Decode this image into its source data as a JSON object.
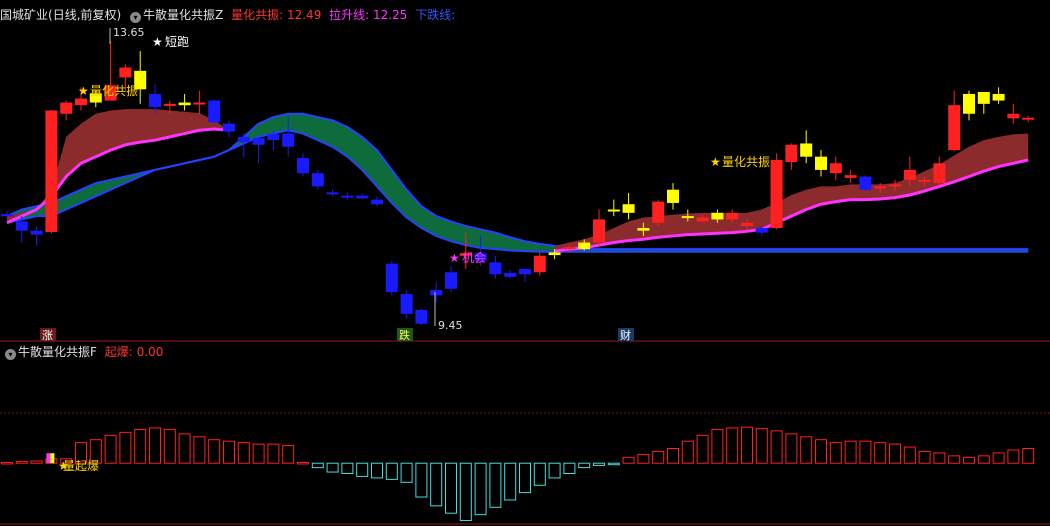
{
  "header_main": {
    "stock": "国城矿业",
    "period": "(日线,前复权)",
    "indicator_name": "牛散量化共振Z",
    "items": [
      {
        "label": "量化共振:",
        "value": "12.49",
        "color": "#ff3333"
      },
      {
        "label": "拉升线:",
        "value": "12.25",
        "color": "#ff33ff"
      },
      {
        "label": "下跌线:",
        "value": "",
        "color": "#3355ff"
      }
    ]
  },
  "header_sub": {
    "indicator_name": "牛散量化共振F",
    "items": [
      {
        "label": "起爆:",
        "value": "0.00",
        "color": "#ff3333"
      }
    ]
  },
  "annotations": {
    "high_label": "13.65",
    "low_label": "9.45",
    "sprint": "短跑",
    "resonance_1": "量化共振",
    "resonance_2": "量化共振",
    "chance": "机会",
    "explosion": "量起爆",
    "tag_zhang": "涨",
    "tag_die": "跌",
    "tag_cai": "财"
  },
  "colors": {
    "up": "#ff2020",
    "down": "#1a1aff",
    "yellow": "#ffff00",
    "upper_band_fill": "#0e6b3c",
    "lower_band_fill": "#8c2b2b",
    "support_line": "#ff33ff",
    "band_edge": "#2244ff",
    "osc_pos": "#ff2020",
    "osc_neg": "#44dddd"
  },
  "chart_data": [
    {
      "type": "candlestick",
      "price_range": [
        9.2,
        14.0
      ],
      "candles": [
        {
          "o": 11.0,
          "h": 11.08,
          "l": 10.96,
          "c": 11.03,
          "k": "down"
        },
        {
          "o": 10.92,
          "h": 11.0,
          "l": 10.6,
          "c": 10.78,
          "k": "down"
        },
        {
          "o": 10.78,
          "h": 10.85,
          "l": 10.55,
          "c": 10.72,
          "k": "down"
        },
        {
          "o": 10.76,
          "h": 12.6,
          "l": 10.74,
          "c": 12.6,
          "k": "up"
        },
        {
          "o": 12.55,
          "h": 12.75,
          "l": 12.45,
          "c": 12.72,
          "k": "up"
        },
        {
          "o": 12.68,
          "h": 12.95,
          "l": 12.6,
          "c": 12.78,
          "k": "up"
        },
        {
          "o": 12.72,
          "h": 12.9,
          "l": 12.65,
          "c": 12.86,
          "k": "yellow"
        },
        {
          "o": 12.75,
          "h": 13.65,
          "l": 12.75,
          "c": 12.98,
          "k": "up"
        },
        {
          "o": 13.1,
          "h": 13.3,
          "l": 12.9,
          "c": 13.25,
          "k": "up"
        },
        {
          "o": 13.2,
          "h": 13.5,
          "l": 12.7,
          "c": 12.92,
          "k": "yellow"
        },
        {
          "o": 12.85,
          "h": 13.0,
          "l": 12.55,
          "c": 12.65,
          "k": "down"
        },
        {
          "o": 12.68,
          "h": 12.75,
          "l": 12.55,
          "c": 12.7,
          "k": "up"
        },
        {
          "o": 12.72,
          "h": 12.85,
          "l": 12.6,
          "c": 12.68,
          "k": "yellow"
        },
        {
          "o": 12.7,
          "h": 12.9,
          "l": 12.55,
          "c": 12.72,
          "k": "up"
        },
        {
          "o": 12.75,
          "h": 12.76,
          "l": 12.4,
          "c": 12.42,
          "k": "down"
        },
        {
          "o": 12.4,
          "h": 12.45,
          "l": 12.2,
          "c": 12.28,
          "k": "down"
        },
        {
          "o": 12.2,
          "h": 12.25,
          "l": 11.9,
          "c": 12.12,
          "k": "down"
        },
        {
          "o": 12.18,
          "h": 12.2,
          "l": 11.8,
          "c": 12.08,
          "k": "down"
        },
        {
          "o": 12.24,
          "h": 12.28,
          "l": 12.0,
          "c": 12.15,
          "k": "down"
        },
        {
          "o": 12.25,
          "h": 12.5,
          "l": 11.9,
          "c": 12.05,
          "k": "down"
        },
        {
          "o": 11.88,
          "h": 11.95,
          "l": 11.6,
          "c": 11.65,
          "k": "down"
        },
        {
          "o": 11.65,
          "h": 11.7,
          "l": 11.4,
          "c": 11.45,
          "k": "down"
        },
        {
          "o": 11.36,
          "h": 11.4,
          "l": 11.3,
          "c": 11.33,
          "k": "down"
        },
        {
          "o": 11.31,
          "h": 11.36,
          "l": 11.25,
          "c": 11.31,
          "k": "down"
        },
        {
          "o": 11.31,
          "h": 11.34,
          "l": 11.26,
          "c": 11.27,
          "k": "down"
        },
        {
          "o": 11.25,
          "h": 11.3,
          "l": 11.15,
          "c": 11.18,
          "k": "down"
        },
        {
          "o": 10.28,
          "h": 10.32,
          "l": 9.8,
          "c": 9.85,
          "k": "down"
        },
        {
          "o": 9.82,
          "h": 9.88,
          "l": 9.45,
          "c": 9.52,
          "k": "down"
        },
        {
          "o": 9.58,
          "h": 9.6,
          "l": 9.35,
          "c": 9.37,
          "k": "down"
        },
        {
          "o": 9.8,
          "h": 10.0,
          "l": 9.7,
          "c": 9.88,
          "k": "down"
        },
        {
          "o": 9.9,
          "h": 10.25,
          "l": 9.85,
          "c": 10.15,
          "k": "down"
        },
        {
          "o": 10.4,
          "h": 10.75,
          "l": 10.2,
          "c": 10.44,
          "k": "up"
        },
        {
          "o": 10.44,
          "h": 10.7,
          "l": 10.25,
          "c": 10.32,
          "k": "down"
        },
        {
          "o": 10.3,
          "h": 10.4,
          "l": 10.05,
          "c": 10.12,
          "k": "down"
        },
        {
          "o": 10.14,
          "h": 10.18,
          "l": 10.05,
          "c": 10.08,
          "k": "down"
        },
        {
          "o": 10.12,
          "h": 10.2,
          "l": 10.0,
          "c": 10.2,
          "k": "down"
        },
        {
          "o": 10.15,
          "h": 10.45,
          "l": 10.1,
          "c": 10.4,
          "k": "up"
        },
        {
          "o": 10.41,
          "h": 10.5,
          "l": 10.35,
          "c": 10.45,
          "k": "yellow"
        },
        {
          "o": 10.52,
          "h": 10.55,
          "l": 10.45,
          "c": 10.53,
          "k": "up"
        },
        {
          "o": 10.5,
          "h": 10.65,
          "l": 10.48,
          "c": 10.6,
          "k": "yellow"
        },
        {
          "o": 10.6,
          "h": 11.1,
          "l": 10.55,
          "c": 10.95,
          "k": "up"
        },
        {
          "o": 11.08,
          "h": 11.25,
          "l": 11.0,
          "c": 11.1,
          "k": "yellow"
        },
        {
          "o": 11.18,
          "h": 11.35,
          "l": 10.95,
          "c": 11.05,
          "k": "yellow"
        },
        {
          "o": 10.82,
          "h": 10.9,
          "l": 10.7,
          "c": 10.78,
          "k": "yellow"
        },
        {
          "o": 10.9,
          "h": 11.25,
          "l": 10.85,
          "c": 11.22,
          "k": "up"
        },
        {
          "o": 11.4,
          "h": 11.5,
          "l": 11.1,
          "c": 11.2,
          "k": "yellow"
        },
        {
          "o": 11.0,
          "h": 11.1,
          "l": 10.92,
          "c": 10.98,
          "k": "yellow"
        },
        {
          "o": 10.98,
          "h": 11.02,
          "l": 10.9,
          "c": 10.92,
          "k": "up"
        },
        {
          "o": 10.95,
          "h": 11.1,
          "l": 10.9,
          "c": 11.05,
          "k": "yellow"
        },
        {
          "o": 11.05,
          "h": 11.1,
          "l": 10.9,
          "c": 10.95,
          "k": "up"
        },
        {
          "o": 10.9,
          "h": 10.95,
          "l": 10.8,
          "c": 10.85,
          "k": "up"
        },
        {
          "o": 10.82,
          "h": 10.85,
          "l": 10.7,
          "c": 10.75,
          "k": "down"
        },
        {
          "o": 10.82,
          "h": 11.95,
          "l": 10.8,
          "c": 11.85,
          "k": "up"
        },
        {
          "o": 11.82,
          "h": 12.1,
          "l": 11.7,
          "c": 12.08,
          "k": "up"
        },
        {
          "o": 11.9,
          "h": 12.3,
          "l": 11.8,
          "c": 12.1,
          "k": "yellow"
        },
        {
          "o": 11.9,
          "h": 12.0,
          "l": 11.6,
          "c": 11.7,
          "k": "yellow"
        },
        {
          "o": 11.8,
          "h": 11.9,
          "l": 11.55,
          "c": 11.65,
          "k": "up"
        },
        {
          "o": 11.62,
          "h": 11.7,
          "l": 11.5,
          "c": 11.58,
          "k": "up"
        },
        {
          "o": 11.6,
          "h": 11.62,
          "l": 11.38,
          "c": 11.4,
          "k": "down"
        },
        {
          "o": 11.42,
          "h": 11.5,
          "l": 11.35,
          "c": 11.45,
          "k": "up"
        },
        {
          "o": 11.45,
          "h": 11.55,
          "l": 11.38,
          "c": 11.48,
          "k": "up"
        },
        {
          "o": 11.55,
          "h": 11.9,
          "l": 11.45,
          "c": 11.7,
          "k": "up"
        },
        {
          "o": 11.52,
          "h": 11.6,
          "l": 11.45,
          "c": 11.55,
          "k": "up"
        },
        {
          "o": 11.5,
          "h": 11.9,
          "l": 11.48,
          "c": 11.8,
          "k": "up"
        },
        {
          "o": 12.0,
          "h": 12.9,
          "l": 11.98,
          "c": 12.68,
          "k": "up"
        },
        {
          "o": 12.85,
          "h": 12.9,
          "l": 12.45,
          "c": 12.55,
          "k": "yellow"
        },
        {
          "o": 12.7,
          "h": 12.75,
          "l": 12.55,
          "c": 12.88,
          "k": "yellow"
        },
        {
          "o": 12.75,
          "h": 12.95,
          "l": 12.7,
          "c": 12.85,
          "k": "yellow"
        },
        {
          "o": 12.55,
          "h": 12.7,
          "l": 12.4,
          "c": 12.48,
          "k": "up"
        },
        {
          "o": 12.48,
          "h": 12.52,
          "l": 12.42,
          "c": 12.49,
          "k": "up"
        }
      ],
      "upper_band_top": [
        11.0,
        11.1,
        11.15,
        11.2,
        11.3,
        11.4,
        11.5,
        11.55,
        11.6,
        11.65,
        11.7,
        11.75,
        11.8,
        11.85,
        11.9,
        12.0,
        12.2,
        12.4,
        12.5,
        12.55,
        12.55,
        12.5,
        12.45,
        12.35,
        12.2,
        12.0,
        11.7,
        11.4,
        11.15,
        11.0,
        10.92,
        10.85,
        10.8,
        10.75,
        10.68,
        10.62,
        10.58,
        10.55,
        10.52,
        10.5,
        10.5,
        10.5,
        10.5,
        10.5,
        10.5,
        10.5,
        10.5,
        10.5,
        10.5,
        10.5,
        10.5,
        10.5,
        10.5,
        10.5,
        10.5,
        10.5,
        10.5,
        10.5,
        10.5,
        10.5,
        10.5,
        10.5,
        10.5,
        10.5,
        10.5,
        10.5,
        10.5,
        10.5,
        10.5,
        10.5
      ],
      "upper_band_bottom": [
        10.9,
        10.95,
        11.0,
        11.0,
        11.1,
        11.2,
        11.3,
        11.4,
        11.5,
        11.6,
        11.7,
        11.75,
        11.8,
        11.85,
        11.9,
        12.0,
        12.1,
        12.2,
        12.25,
        12.3,
        12.25,
        12.15,
        12.05,
        11.9,
        11.7,
        11.45,
        11.2,
        10.98,
        10.82,
        10.7,
        10.62,
        10.56,
        10.52,
        10.5,
        10.48,
        10.47,
        10.46,
        10.46,
        10.46,
        10.46,
        10.46,
        10.46,
        10.46,
        10.46,
        10.46,
        10.46,
        10.46,
        10.46,
        10.46,
        10.46,
        10.46,
        10.46,
        10.46,
        10.46,
        10.46,
        10.46,
        10.46,
        10.46,
        10.46,
        10.46,
        10.46,
        10.46,
        10.46,
        10.46,
        10.46,
        10.46,
        10.46,
        10.46,
        10.46,
        10.46
      ],
      "lower_band_top": [
        11.0,
        11.05,
        11.1,
        11.4,
        12.2,
        12.4,
        12.55,
        12.6,
        12.62,
        12.62,
        12.62,
        12.6,
        12.58,
        12.56,
        12.45,
        12.3,
        null,
        null,
        null,
        null,
        null,
        null,
        null,
        null,
        null,
        null,
        null,
        null,
        null,
        null,
        null,
        null,
        null,
        null,
        null,
        null,
        null,
        10.55,
        10.6,
        10.65,
        10.72,
        10.82,
        10.92,
        10.98,
        11.0,
        11.02,
        11.04,
        11.05,
        11.05,
        11.05,
        11.05,
        11.1,
        11.2,
        11.32,
        11.4,
        11.45,
        11.45,
        11.48,
        11.48,
        11.48,
        11.5,
        11.58,
        11.68,
        11.78,
        11.92,
        12.05,
        12.15,
        12.2,
        12.24,
        12.25
      ],
      "support_line": [
        10.9,
        11.0,
        11.1,
        11.3,
        11.6,
        11.8,
        11.9,
        12.0,
        12.08,
        12.12,
        12.15,
        12.2,
        12.25,
        12.3,
        12.32,
        12.3,
        null,
        null,
        null,
        null,
        null,
        null,
        null,
        null,
        null,
        null,
        null,
        null,
        null,
        null,
        null,
        null,
        null,
        null,
        null,
        null,
        null,
        10.47,
        10.5,
        10.52,
        10.56,
        10.6,
        10.63,
        10.65,
        10.68,
        10.7,
        10.72,
        10.73,
        10.74,
        10.75,
        10.77,
        10.8,
        10.9,
        11.0,
        11.1,
        11.18,
        11.22,
        11.25,
        11.25,
        11.26,
        11.28,
        11.32,
        11.38,
        11.45,
        11.52,
        11.6,
        11.68,
        11.75,
        11.8,
        11.85
      ]
    },
    {
      "type": "bar",
      "label": "起爆",
      "value_range": [
        -4.0,
        2.6
      ],
      "values": [
        0.05,
        0.12,
        0.15,
        0.3,
        0.3,
        1.4,
        1.6,
        1.9,
        2.1,
        2.3,
        2.4,
        2.3,
        2.0,
        1.8,
        1.6,
        1.5,
        1.4,
        1.3,
        1.3,
        1.2,
        0.05,
        -0.3,
        -0.6,
        -0.7,
        -0.9,
        -1.0,
        -1.1,
        -1.3,
        -2.3,
        -2.9,
        -3.4,
        -3.9,
        -3.5,
        -3.0,
        -2.5,
        -2.0,
        -1.5,
        -1.0,
        -0.7,
        -0.3,
        -0.15,
        -0.05,
        0.4,
        0.6,
        0.8,
        1.0,
        1.5,
        1.9,
        2.3,
        2.4,
        2.45,
        2.35,
        2.2,
        2.0,
        1.8,
        1.6,
        1.4,
        1.5,
        1.5,
        1.4,
        1.3,
        1.1,
        0.8,
        0.7,
        0.5,
        0.4,
        0.5,
        0.7,
        0.9,
        1.0
      ],
      "markers": [
        {
          "index": 3,
          "kind": "magenta-yellow"
        }
      ]
    }
  ]
}
